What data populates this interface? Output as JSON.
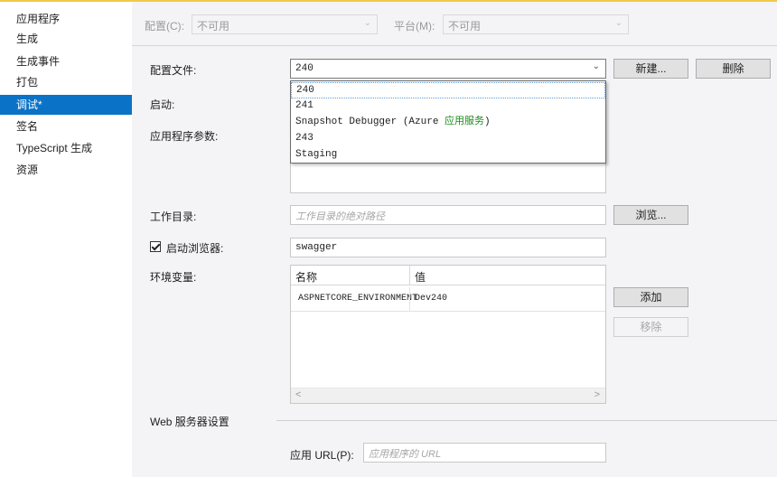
{
  "sidebar": {
    "items": [
      {
        "label": "应用程序",
        "active": false
      },
      {
        "label": "生成",
        "active": false
      },
      {
        "label": "生成事件",
        "active": false
      },
      {
        "label": "打包",
        "active": false
      },
      {
        "label": "调试*",
        "active": true
      },
      {
        "label": "签名",
        "active": false
      },
      {
        "label": "TypeScript 生成",
        "active": false
      },
      {
        "label": "资源",
        "active": false
      }
    ]
  },
  "config_bar": {
    "config_label": "配置(C):",
    "config_value": "不可用",
    "platform_label": "平台(M):",
    "platform_value": "不可用"
  },
  "profile": {
    "label": "配置文件:",
    "value": "240",
    "new_button": "新建...",
    "delete_button": "删除",
    "options": [
      {
        "text": "240"
      },
      {
        "text": "241"
      },
      {
        "text": "Snapshot Debugger (Azure ",
        "accent": "应用服务",
        "suffix": ")"
      },
      {
        "text": "243"
      },
      {
        "text": "Staging"
      }
    ]
  },
  "launch": {
    "label": "启动:"
  },
  "app_args": {
    "label": "应用程序参数:"
  },
  "working_dir": {
    "label": "工作目录:",
    "placeholder": "工作目录的绝对路径",
    "browse_button": "浏览..."
  },
  "launch_browser": {
    "label": "启动浏览器:",
    "checked": true,
    "value": "swagger"
  },
  "env": {
    "label": "环境变量:",
    "columns": [
      "名称",
      "值"
    ],
    "rows": [
      {
        "name": "ASPNETCORE_ENVIRONMENT",
        "value": "Dev240"
      }
    ],
    "add_button": "添加",
    "remove_button": "移除"
  },
  "web_server": {
    "section_label": "Web 服务器设置",
    "url_label": "应用 URL(P):",
    "url_placeholder": "应用程序的 URL"
  },
  "colors": {
    "accent": "#0a73c7",
    "panel": "#f4f4f6",
    "highlight_text": "#1e8a1e"
  }
}
